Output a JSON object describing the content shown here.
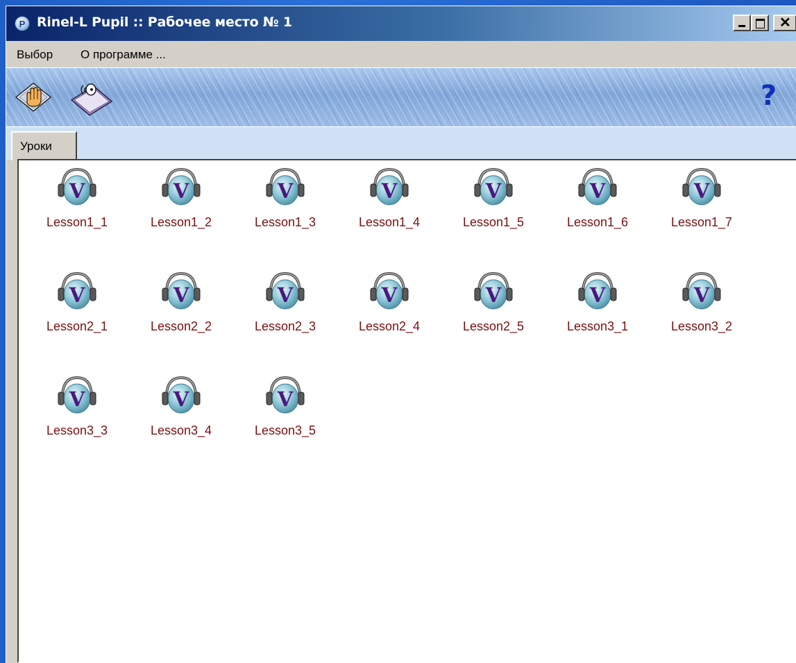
{
  "window": {
    "app_icon_letter": "P",
    "title": "Rinel-L Pupil :: Рабочее место № 1"
  },
  "menu": {
    "items": [
      "Выбор",
      "О программе ..."
    ]
  },
  "toolbar": {
    "tools": [
      "hand-raise-icon",
      "voice-sound-icon"
    ],
    "help_label": "?"
  },
  "tabs": [
    {
      "label": "Уроки",
      "active": true
    }
  ],
  "lessons": [
    {
      "label": "Lesson1_1",
      "icon": "headphones-v-icon"
    },
    {
      "label": "Lesson1_2",
      "icon": "headphones-v-icon"
    },
    {
      "label": "Lesson1_3",
      "icon": "headphones-v-icon"
    },
    {
      "label": "Lesson1_4",
      "icon": "headphones-v-icon"
    },
    {
      "label": "Lesson1_5",
      "icon": "headphones-v-icon"
    },
    {
      "label": "Lesson1_6",
      "icon": "headphones-v-icon"
    },
    {
      "label": "Lesson1_7",
      "icon": "headphones-v-icon"
    },
    {
      "label": "Lesson2_1",
      "icon": "headphones-v-icon"
    },
    {
      "label": "Lesson2_2",
      "icon": "headphones-v-icon"
    },
    {
      "label": "Lesson2_3",
      "icon": "headphones-v-icon"
    },
    {
      "label": "Lesson2_4",
      "icon": "headphones-v-icon"
    },
    {
      "label": "Lesson2_5",
      "icon": "headphones-v-icon"
    },
    {
      "label": "Lesson3_1",
      "icon": "headphones-v-icon"
    },
    {
      "label": "Lesson3_2",
      "icon": "headphones-v-icon"
    },
    {
      "label": "Lesson3_3",
      "icon": "headphones-v-icon"
    },
    {
      "label": "Lesson3_4",
      "icon": "headphones-v-icon"
    },
    {
      "label": "Lesson3_5",
      "icon": "headphones-v-icon"
    }
  ],
  "lesson_icon_letter": "V",
  "colors": {
    "title_bar_start": "#0a246a",
    "title_bar_end": "#a6caf0",
    "lesson_label": "#7a1010",
    "help_mark": "#1030b8",
    "icon_v": "#4a1a80"
  }
}
